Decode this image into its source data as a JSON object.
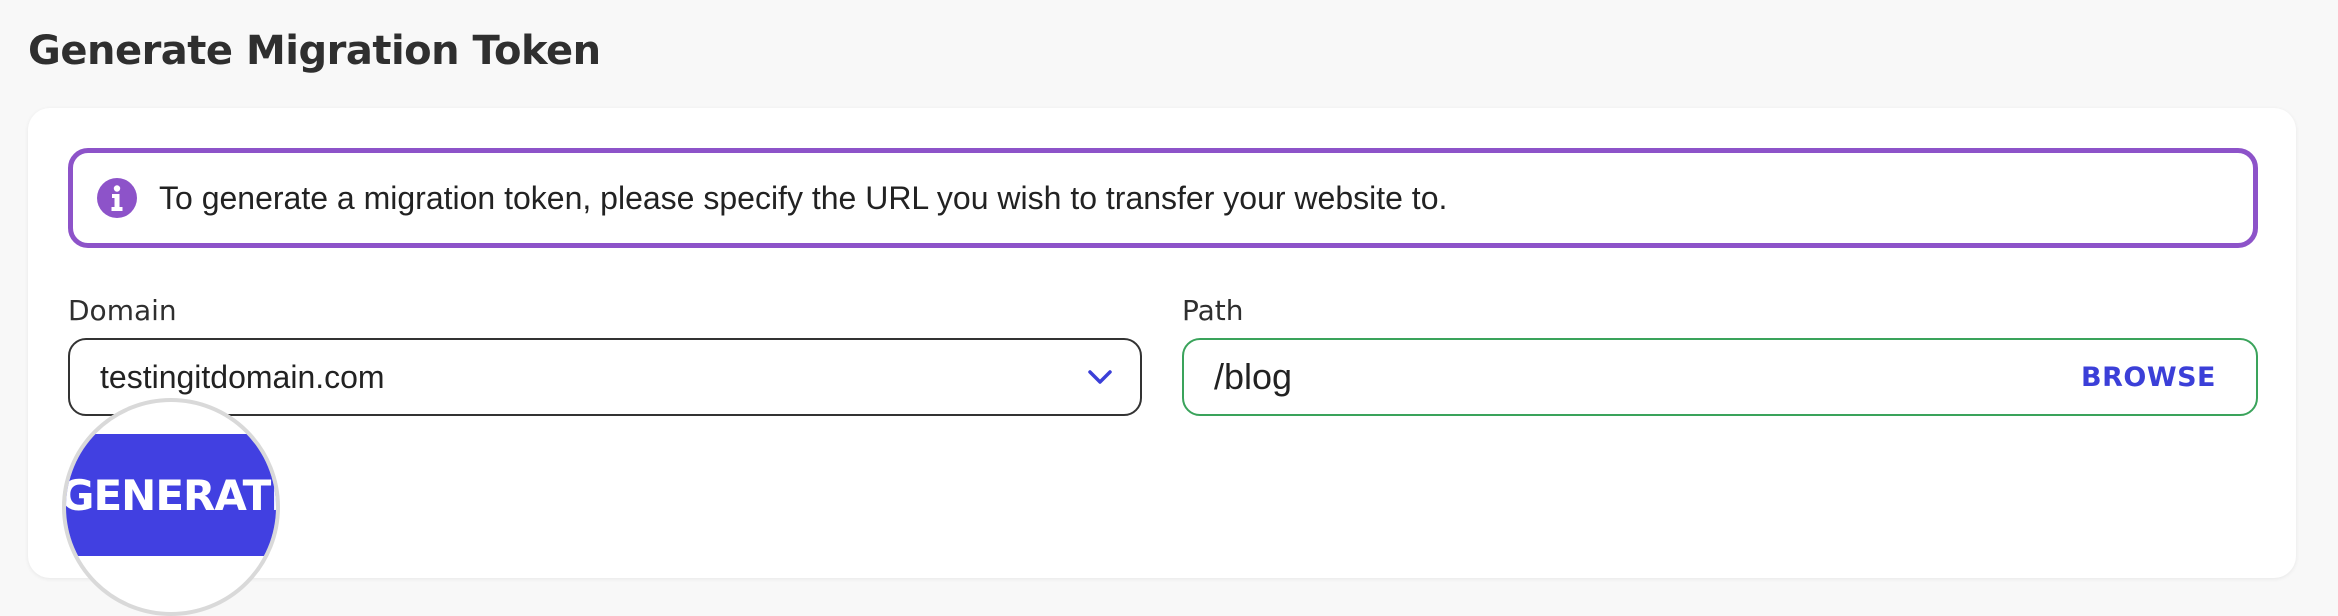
{
  "page": {
    "title": "Generate Migration Token"
  },
  "notice": {
    "icon": "info-icon",
    "text": "To generate a migration token, please specify the URL you wish to transfer your website to.",
    "accent": "#8d53c9"
  },
  "domain": {
    "label": "Domain",
    "value": "testingitdomain.com",
    "icon": "chevron-down-icon"
  },
  "path": {
    "label": "Path",
    "value": "/blog",
    "browse_label": "BROWSE",
    "accent": "#3aa35b"
  },
  "actions": {
    "generate_label": "GENERATE",
    "color": "#4140e1"
  }
}
